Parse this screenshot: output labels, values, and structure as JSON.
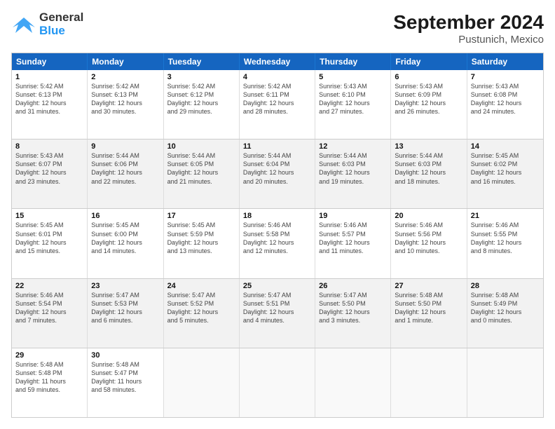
{
  "logo": {
    "general": "General",
    "blue": "Blue"
  },
  "title": "September 2024",
  "subtitle": "Pustunich, Mexico",
  "days": [
    "Sunday",
    "Monday",
    "Tuesday",
    "Wednesday",
    "Thursday",
    "Friday",
    "Saturday"
  ],
  "weeks": [
    [
      {
        "day": "1",
        "info": "Sunrise: 5:42 AM\nSunset: 6:13 PM\nDaylight: 12 hours\nand 31 minutes."
      },
      {
        "day": "2",
        "info": "Sunrise: 5:42 AM\nSunset: 6:13 PM\nDaylight: 12 hours\nand 30 minutes."
      },
      {
        "day": "3",
        "info": "Sunrise: 5:42 AM\nSunset: 6:12 PM\nDaylight: 12 hours\nand 29 minutes."
      },
      {
        "day": "4",
        "info": "Sunrise: 5:42 AM\nSunset: 6:11 PM\nDaylight: 12 hours\nand 28 minutes."
      },
      {
        "day": "5",
        "info": "Sunrise: 5:43 AM\nSunset: 6:10 PM\nDaylight: 12 hours\nand 27 minutes."
      },
      {
        "day": "6",
        "info": "Sunrise: 5:43 AM\nSunset: 6:09 PM\nDaylight: 12 hours\nand 26 minutes."
      },
      {
        "day": "7",
        "info": "Sunrise: 5:43 AM\nSunset: 6:08 PM\nDaylight: 12 hours\nand 24 minutes."
      }
    ],
    [
      {
        "day": "8",
        "info": "Sunrise: 5:43 AM\nSunset: 6:07 PM\nDaylight: 12 hours\nand 23 minutes."
      },
      {
        "day": "9",
        "info": "Sunrise: 5:44 AM\nSunset: 6:06 PM\nDaylight: 12 hours\nand 22 minutes."
      },
      {
        "day": "10",
        "info": "Sunrise: 5:44 AM\nSunset: 6:05 PM\nDaylight: 12 hours\nand 21 minutes."
      },
      {
        "day": "11",
        "info": "Sunrise: 5:44 AM\nSunset: 6:04 PM\nDaylight: 12 hours\nand 20 minutes."
      },
      {
        "day": "12",
        "info": "Sunrise: 5:44 AM\nSunset: 6:03 PM\nDaylight: 12 hours\nand 19 minutes."
      },
      {
        "day": "13",
        "info": "Sunrise: 5:44 AM\nSunset: 6:03 PM\nDaylight: 12 hours\nand 18 minutes."
      },
      {
        "day": "14",
        "info": "Sunrise: 5:45 AM\nSunset: 6:02 PM\nDaylight: 12 hours\nand 16 minutes."
      }
    ],
    [
      {
        "day": "15",
        "info": "Sunrise: 5:45 AM\nSunset: 6:01 PM\nDaylight: 12 hours\nand 15 minutes."
      },
      {
        "day": "16",
        "info": "Sunrise: 5:45 AM\nSunset: 6:00 PM\nDaylight: 12 hours\nand 14 minutes."
      },
      {
        "day": "17",
        "info": "Sunrise: 5:45 AM\nSunset: 5:59 PM\nDaylight: 12 hours\nand 13 minutes."
      },
      {
        "day": "18",
        "info": "Sunrise: 5:46 AM\nSunset: 5:58 PM\nDaylight: 12 hours\nand 12 minutes."
      },
      {
        "day": "19",
        "info": "Sunrise: 5:46 AM\nSunset: 5:57 PM\nDaylight: 12 hours\nand 11 minutes."
      },
      {
        "day": "20",
        "info": "Sunrise: 5:46 AM\nSunset: 5:56 PM\nDaylight: 12 hours\nand 10 minutes."
      },
      {
        "day": "21",
        "info": "Sunrise: 5:46 AM\nSunset: 5:55 PM\nDaylight: 12 hours\nand 8 minutes."
      }
    ],
    [
      {
        "day": "22",
        "info": "Sunrise: 5:46 AM\nSunset: 5:54 PM\nDaylight: 12 hours\nand 7 minutes."
      },
      {
        "day": "23",
        "info": "Sunrise: 5:47 AM\nSunset: 5:53 PM\nDaylight: 12 hours\nand 6 minutes."
      },
      {
        "day": "24",
        "info": "Sunrise: 5:47 AM\nSunset: 5:52 PM\nDaylight: 12 hours\nand 5 minutes."
      },
      {
        "day": "25",
        "info": "Sunrise: 5:47 AM\nSunset: 5:51 PM\nDaylight: 12 hours\nand 4 minutes."
      },
      {
        "day": "26",
        "info": "Sunrise: 5:47 AM\nSunset: 5:50 PM\nDaylight: 12 hours\nand 3 minutes."
      },
      {
        "day": "27",
        "info": "Sunrise: 5:48 AM\nSunset: 5:50 PM\nDaylight: 12 hours\nand 1 minute."
      },
      {
        "day": "28",
        "info": "Sunrise: 5:48 AM\nSunset: 5:49 PM\nDaylight: 12 hours\nand 0 minutes."
      }
    ],
    [
      {
        "day": "29",
        "info": "Sunrise: 5:48 AM\nSunset: 5:48 PM\nDaylight: 11 hours\nand 59 minutes."
      },
      {
        "day": "30",
        "info": "Sunrise: 5:48 AM\nSunset: 5:47 PM\nDaylight: 11 hours\nand 58 minutes."
      },
      {
        "day": "",
        "info": ""
      },
      {
        "day": "",
        "info": ""
      },
      {
        "day": "",
        "info": ""
      },
      {
        "day": "",
        "info": ""
      },
      {
        "day": "",
        "info": ""
      }
    ]
  ]
}
